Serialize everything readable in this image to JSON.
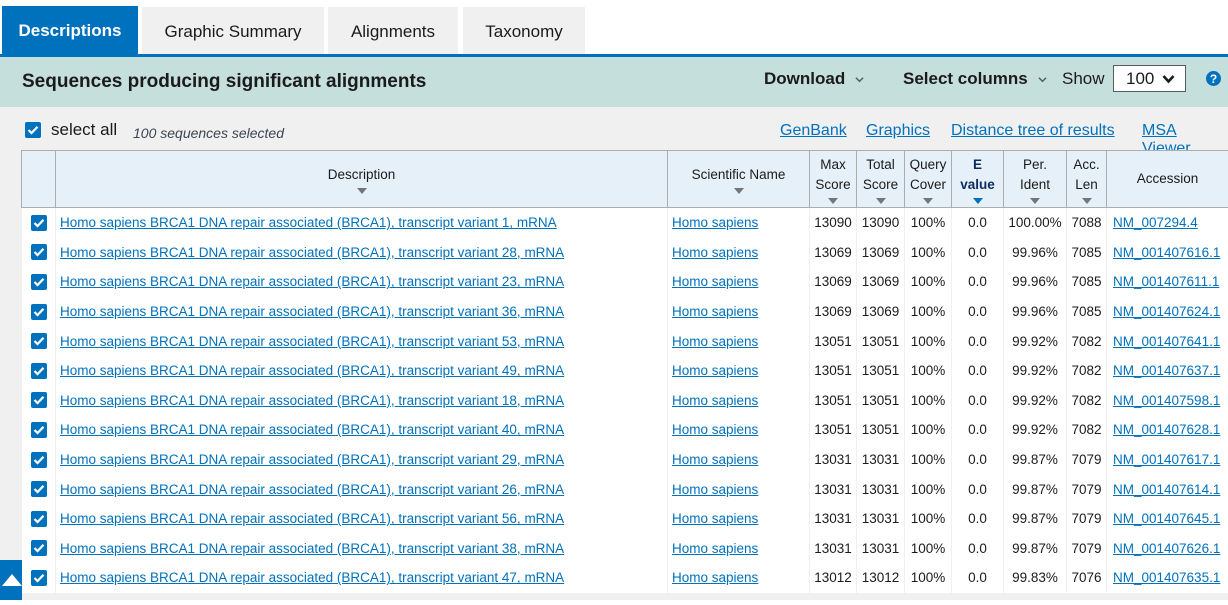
{
  "tabs": [
    {
      "label": "Descriptions",
      "active": true
    },
    {
      "label": "Graphic Summary",
      "active": false
    },
    {
      "label": "Alignments",
      "active": false
    },
    {
      "label": "Taxonomy",
      "active": false
    }
  ],
  "header": {
    "title": "Sequences producing significant alignments",
    "download_label": "Download",
    "select_columns_label": "Select columns",
    "show_label": "Show",
    "show_value": "100",
    "help_icon": "?"
  },
  "toolbar": {
    "select_all_label": "select all",
    "selected_count": "100 sequences selected",
    "links": [
      "GenBank",
      "Graphics",
      "Distance tree of results",
      "MSA Viewer"
    ]
  },
  "table": {
    "columns": [
      {
        "line1": "Description",
        "line2": ""
      },
      {
        "line1": "Scientific Name",
        "line2": ""
      },
      {
        "line1": "Max",
        "line2": "Score"
      },
      {
        "line1": "Total",
        "line2": "Score"
      },
      {
        "line1": "Query",
        "line2": "Cover"
      },
      {
        "line1": "E",
        "line2": "value"
      },
      {
        "line1": "Per.",
        "line2": "Ident"
      },
      {
        "line1": "Acc.",
        "line2": "Len"
      },
      {
        "line1": "Accession",
        "line2": ""
      }
    ],
    "rows": [
      {
        "description": "Homo sapiens BRCA1 DNA repair associated (BRCA1), transcript variant 1, mRNA",
        "sci_name": "Homo sapiens",
        "max_score": "13090",
        "total_score": "13090",
        "query_cover": "100%",
        "e_value": "0.0",
        "per_ident": "100.00%",
        "acc_len": "7088",
        "accession": "NM_007294.4"
      },
      {
        "description": "Homo sapiens BRCA1 DNA repair associated (BRCA1), transcript variant 28, mRNA",
        "sci_name": "Homo sapiens",
        "max_score": "13069",
        "total_score": "13069",
        "query_cover": "100%",
        "e_value": "0.0",
        "per_ident": "99.96%",
        "acc_len": "7085",
        "accession": "NM_001407616.1"
      },
      {
        "description": "Homo sapiens BRCA1 DNA repair associated (BRCA1), transcript variant 23, mRNA",
        "sci_name": "Homo sapiens",
        "max_score": "13069",
        "total_score": "13069",
        "query_cover": "100%",
        "e_value": "0.0",
        "per_ident": "99.96%",
        "acc_len": "7085",
        "accession": "NM_001407611.1"
      },
      {
        "description": "Homo sapiens BRCA1 DNA repair associated (BRCA1), transcript variant 36, mRNA",
        "sci_name": "Homo sapiens",
        "max_score": "13069",
        "total_score": "13069",
        "query_cover": "100%",
        "e_value": "0.0",
        "per_ident": "99.96%",
        "acc_len": "7085",
        "accession": "NM_001407624.1"
      },
      {
        "description": "Homo sapiens BRCA1 DNA repair associated (BRCA1), transcript variant 53, mRNA",
        "sci_name": "Homo sapiens",
        "max_score": "13051",
        "total_score": "13051",
        "query_cover": "100%",
        "e_value": "0.0",
        "per_ident": "99.92%",
        "acc_len": "7082",
        "accession": "NM_001407641.1"
      },
      {
        "description": "Homo sapiens BRCA1 DNA repair associated (BRCA1), transcript variant 49, mRNA",
        "sci_name": "Homo sapiens",
        "max_score": "13051",
        "total_score": "13051",
        "query_cover": "100%",
        "e_value": "0.0",
        "per_ident": "99.92%",
        "acc_len": "7082",
        "accession": "NM_001407637.1"
      },
      {
        "description": "Homo sapiens BRCA1 DNA repair associated (BRCA1), transcript variant 18, mRNA",
        "sci_name": "Homo sapiens",
        "max_score": "13051",
        "total_score": "13051",
        "query_cover": "100%",
        "e_value": "0.0",
        "per_ident": "99.92%",
        "acc_len": "7082",
        "accession": "NM_001407598.1"
      },
      {
        "description": "Homo sapiens BRCA1 DNA repair associated (BRCA1), transcript variant 40, mRNA",
        "sci_name": "Homo sapiens",
        "max_score": "13051",
        "total_score": "13051",
        "query_cover": "100%",
        "e_value": "0.0",
        "per_ident": "99.92%",
        "acc_len": "7082",
        "accession": "NM_001407628.1"
      },
      {
        "description": "Homo sapiens BRCA1 DNA repair associated (BRCA1), transcript variant 29, mRNA",
        "sci_name": "Homo sapiens",
        "max_score": "13031",
        "total_score": "13031",
        "query_cover": "100%",
        "e_value": "0.0",
        "per_ident": "99.87%",
        "acc_len": "7079",
        "accession": "NM_001407617.1"
      },
      {
        "description": "Homo sapiens BRCA1 DNA repair associated (BRCA1), transcript variant 26, mRNA",
        "sci_name": "Homo sapiens",
        "max_score": "13031",
        "total_score": "13031",
        "query_cover": "100%",
        "e_value": "0.0",
        "per_ident": "99.87%",
        "acc_len": "7079",
        "accession": "NM_001407614.1"
      },
      {
        "description": "Homo sapiens BRCA1 DNA repair associated (BRCA1), transcript variant 56, mRNA",
        "sci_name": "Homo sapiens",
        "max_score": "13031",
        "total_score": "13031",
        "query_cover": "100%",
        "e_value": "0.0",
        "per_ident": "99.87%",
        "acc_len": "7079",
        "accession": "NM_001407645.1"
      },
      {
        "description": "Homo sapiens BRCA1 DNA repair associated (BRCA1), transcript variant 38, mRNA",
        "sci_name": "Homo sapiens",
        "max_score": "13031",
        "total_score": "13031",
        "query_cover": "100%",
        "e_value": "0.0",
        "per_ident": "99.87%",
        "acc_len": "7079",
        "accession": "NM_001407626.1"
      },
      {
        "description": "Homo sapiens BRCA1 DNA repair associated (BRCA1), transcript variant 47, mRNA",
        "sci_name": "Homo sapiens",
        "max_score": "13012",
        "total_score": "13012",
        "query_cover": "100%",
        "e_value": "0.0",
        "per_ident": "99.83%",
        "acc_len": "7076",
        "accession": "NM_001407635.1"
      }
    ]
  },
  "colors": {
    "primary": "#0071bc",
    "band": "#c5dfdc",
    "header_bg": "#e6f0f9",
    "page_bg": "#f0f0f0"
  }
}
